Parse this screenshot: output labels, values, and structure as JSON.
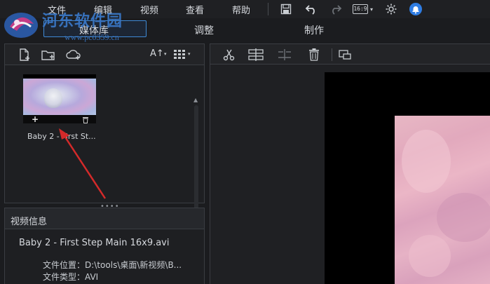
{
  "menu": {
    "items": [
      "文件",
      "编辑",
      "视频",
      "查看",
      "帮助"
    ],
    "ratio": "16:9"
  },
  "watermark": {
    "name": "河东软件园",
    "url": "www.pc0359.cn"
  },
  "tabs": {
    "media": "媒体库",
    "adjust": "调整",
    "make": "制作"
  },
  "media": {
    "sort_label": "A↑",
    "items": [
      {
        "caption": "Baby 2 - First St..."
      }
    ]
  },
  "info": {
    "title": "视频信息",
    "filename": "Baby 2 - First Step Main 16x9.avi",
    "rows": [
      {
        "label": "文件位置：",
        "value": "D:\\tools\\桌面\\新视频\\B..."
      },
      {
        "label": "文件类型：",
        "value": "AVI"
      }
    ]
  },
  "colors": {
    "accent": "#3f8ad6",
    "arrow": "#d42a2a",
    "bell": "#2f7de3"
  }
}
